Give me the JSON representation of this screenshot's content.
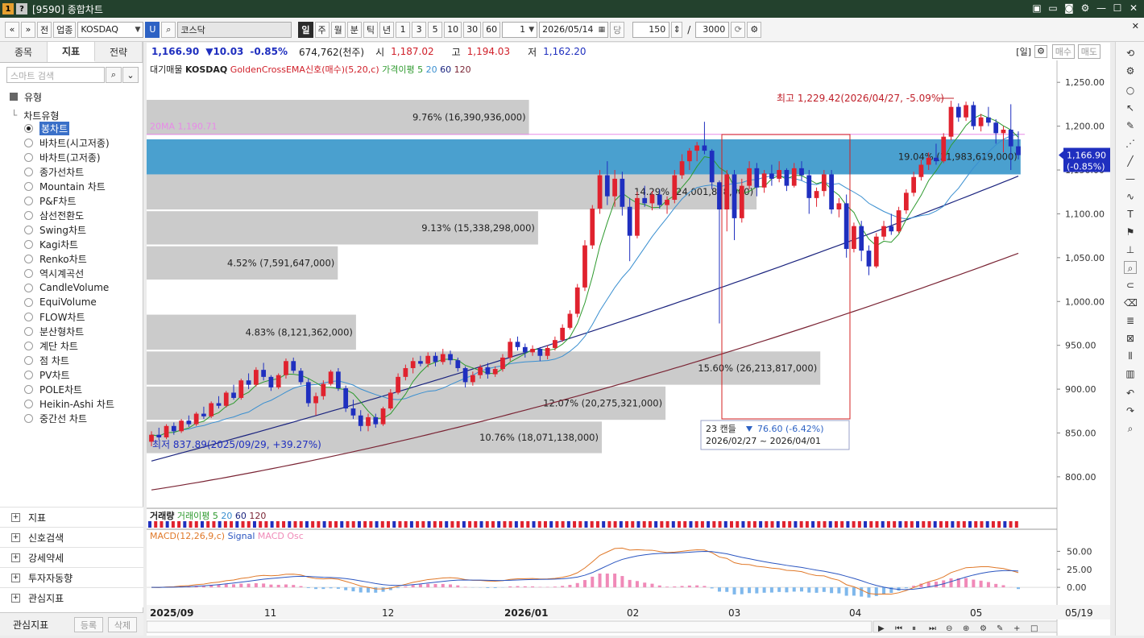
{
  "window": {
    "badge1": "1",
    "badge2": "?",
    "title": "[9590] 종합차트",
    "controls": [
      "▣",
      "▭",
      "◙",
      "⚙",
      "—",
      "☐",
      "✕"
    ]
  },
  "toolbar": {
    "nav_prev": "«",
    "nav_down": "»",
    "btn_prev": "전",
    "btn_sector": "업종",
    "symbol": "KOSDAQ",
    "symbol_code_badge": "U",
    "market": "코스닥",
    "periods": [
      "일",
      "주",
      "월",
      "분",
      "틱",
      "년"
    ],
    "active_period": "일",
    "intervals": [
      "1",
      "3",
      "5",
      "10",
      "30",
      "60"
    ],
    "count_select": "1",
    "date": "2026/05/14",
    "date_unit_btn": "당",
    "bars": "150",
    "slash": "/",
    "max_bars": "3000"
  },
  "left": {
    "tabs": [
      "종목",
      "지표",
      "전략"
    ],
    "active_tab": "지표",
    "search_placeholder": "스마트 검색",
    "section": "유형",
    "tree_group": "차트유형",
    "chart_types": [
      "봉차트",
      "바차트(시고저종)",
      "바차트(고저종)",
      "종가선차트",
      "Mountain 차트",
      "P&F차트",
      "삼선전환도",
      "Swing차트",
      "Kagi차트",
      "Renko차트",
      "역시계곡선",
      "CandleVolume",
      "EquiVolume",
      "FLOW차트",
      "분산형차트",
      "계단 차트",
      "점 차트",
      "PV차트",
      "POLE차트",
      "Heikin-Ashi 차트",
      "중간선 차트"
    ],
    "selected_type": "봉차트",
    "accordions": [
      "지표",
      "신호검색",
      "강세약세",
      "투자자동향",
      "관심지표"
    ],
    "footer": {
      "label": "관심지표",
      "register": "등록",
      "delete": "삭제"
    }
  },
  "pricebar": {
    "price": "1,166.90",
    "change": "▼10.03",
    "pct": "-0.85%",
    "volume": "674,762(천주)",
    "open_label": "시",
    "open": "1,187.02",
    "high_label": "고",
    "high": "1,194.03",
    "low_label": "저",
    "low": "1,162.20",
    "period_badge": "[일]",
    "buy": "매수",
    "sell": "매도"
  },
  "main_legend": {
    "items": [
      "대기매물",
      "KOSDAQ",
      "GoldenCrossEMA신호(매수)(5,20,c)",
      "가격이평 5",
      "20",
      "60",
      "120"
    ]
  },
  "annotations": {
    "high": "최고 1,229.42(2026/04/27, -5.09%)",
    "low": "최저 837.89(2025/09/29, +39.27%)",
    "ma20": "20MA 1,190.71",
    "price_tag": "1,166.90",
    "pct_tag": "(-0.85%)",
    "box_line1": "23 캔들",
    "box_value": "76.60 (-6.42%)",
    "box_line2": "2026/02/27 ~ 2026/04/01"
  },
  "volume_profile": [
    {
      "low": 1190,
      "high": 1230,
      "width": 0.42,
      "label": "9.76% (16,390,936,000)",
      "hl": false
    },
    {
      "low": 1145,
      "high": 1185,
      "width": 0.96,
      "label": "19.04% (31,983,619,000)",
      "hl": true
    },
    {
      "low": 1105,
      "high": 1145,
      "width": 0.67,
      "label": "14.29% (24,001,828,000)",
      "hl": false
    },
    {
      "low": 1065,
      "high": 1103,
      "width": 0.43,
      "label": "9.13% (15,338,298,000)",
      "hl": false
    },
    {
      "low": 1025,
      "high": 1063,
      "width": 0.21,
      "label": "4.52% (7,591,647,000)",
      "hl": false
    },
    {
      "low": 945,
      "high": 985,
      "width": 0.23,
      "label": "4.83% (8,121,362,000)",
      "hl": false
    },
    {
      "low": 905,
      "high": 943,
      "width": 0.74,
      "label": "15.60% (26,213,817,000)",
      "hl": false
    },
    {
      "low": 865,
      "high": 903,
      "width": 0.57,
      "label": "12.07% (20,275,321,000)",
      "hl": false
    },
    {
      "low": 827,
      "high": 863,
      "width": 0.5,
      "label": "10.76% (18,071,138,000)",
      "hl": false
    }
  ],
  "volume_legend": {
    "items": [
      "거래량",
      "거래이평 5",
      "20",
      "60",
      "120"
    ]
  },
  "macd_legend": {
    "items": [
      "MACD(12,26,9,c)",
      "Signal",
      "MACD Osc"
    ]
  },
  "chart_data": {
    "type": "candlestick",
    "y_axis_ticks": [
      "1,250.00",
      "1,200.00",
      "1,150.00",
      "1,100.00",
      "1,050.00",
      "1,000.00",
      "950.00",
      "900.00",
      "850.00",
      "800.00"
    ],
    "ylim": [
      765,
      1275
    ],
    "macd_ticks": [
      "50.00",
      "25.00",
      "0.00"
    ],
    "macd_ylim": [
      -20,
      65
    ],
    "x_labels": [
      "2025/09",
      "11",
      "12",
      "2026/01",
      "02",
      "03",
      "04",
      "05"
    ],
    "last_date": "05/19",
    "candles": [
      [
        840,
        852,
        835,
        848
      ],
      [
        848,
        856,
        842,
        845
      ],
      [
        845,
        860,
        843,
        858
      ],
      [
        858,
        862,
        848,
        852
      ],
      [
        852,
        866,
        850,
        864
      ],
      [
        864,
        870,
        857,
        860
      ],
      [
        860,
        874,
        858,
        872
      ],
      [
        872,
        880,
        866,
        869
      ],
      [
        869,
        886,
        867,
        884
      ],
      [
        884,
        892,
        878,
        881
      ],
      [
        881,
        898,
        879,
        896
      ],
      [
        896,
        905,
        888,
        890
      ],
      [
        890,
        912,
        888,
        910
      ],
      [
        910,
        918,
        900,
        905
      ],
      [
        905,
        925,
        903,
        922
      ],
      [
        922,
        930,
        910,
        914
      ],
      [
        914,
        916,
        898,
        902
      ],
      [
        902,
        918,
        900,
        916
      ],
      [
        916,
        935,
        912,
        932
      ],
      [
        932,
        936,
        918,
        921
      ],
      [
        921,
        924,
        905,
        908
      ],
      [
        908,
        912,
        880,
        884
      ],
      [
        884,
        896,
        870,
        892
      ],
      [
        892,
        910,
        888,
        906
      ],
      [
        906,
        922,
        904,
        920
      ],
      [
        920,
        924,
        898,
        901
      ],
      [
        901,
        904,
        874,
        878
      ],
      [
        878,
        888,
        866,
        870
      ],
      [
        870,
        876,
        852,
        858
      ],
      [
        858,
        872,
        852,
        868
      ],
      [
        868,
        872,
        856,
        860
      ],
      [
        860,
        880,
        858,
        878
      ],
      [
        878,
        900,
        876,
        896
      ],
      [
        896,
        918,
        894,
        914
      ],
      [
        914,
        928,
        910,
        924
      ],
      [
        924,
        936,
        918,
        932
      ],
      [
        932,
        938,
        926,
        929
      ],
      [
        929,
        942,
        925,
        938
      ],
      [
        938,
        942,
        926,
        931
      ],
      [
        931,
        946,
        928,
        940
      ],
      [
        940,
        944,
        928,
        933
      ],
      [
        933,
        936,
        920,
        924
      ],
      [
        924,
        926,
        902,
        908
      ],
      [
        908,
        920,
        904,
        916
      ],
      [
        916,
        928,
        912,
        925
      ],
      [
        925,
        930,
        912,
        917
      ],
      [
        917,
        926,
        914,
        923
      ],
      [
        923,
        940,
        920,
        936
      ],
      [
        936,
        958,
        932,
        954
      ],
      [
        954,
        960,
        944,
        948
      ],
      [
        948,
        952,
        936,
        942
      ],
      [
        942,
        950,
        938,
        946
      ],
      [
        946,
        948,
        932,
        938
      ],
      [
        938,
        950,
        934,
        947
      ],
      [
        947,
        960,
        944,
        956
      ],
      [
        956,
        974,
        954,
        970
      ],
      [
        970,
        990,
        968,
        986
      ],
      [
        986,
        1020,
        982,
        1016
      ],
      [
        1016,
        1070,
        1012,
        1064
      ],
      [
        1064,
        1110,
        1060,
        1106
      ],
      [
        1106,
        1150,
        1100,
        1144
      ],
      [
        1144,
        1160,
        1110,
        1120
      ],
      [
        1120,
        1150,
        1108,
        1140
      ],
      [
        1140,
        1148,
        1098,
        1108
      ],
      [
        1108,
        1118,
        1046,
        1075
      ],
      [
        1075,
        1125,
        1072,
        1118
      ],
      [
        1118,
        1132,
        1108,
        1112
      ],
      [
        1112,
        1126,
        1104,
        1122
      ],
      [
        1122,
        1128,
        1106,
        1110
      ],
      [
        1110,
        1120,
        1100,
        1116
      ],
      [
        1116,
        1150,
        1112,
        1144
      ],
      [
        1144,
        1168,
        1140,
        1160
      ],
      [
        1160,
        1175,
        1150,
        1172
      ],
      [
        1172,
        1182,
        1160,
        1178
      ],
      [
        1178,
        1205,
        1168,
        1172
      ],
      [
        1172,
        1174,
        1128,
        1136
      ],
      [
        1136,
        1138,
        975,
        1105
      ],
      [
        1105,
        1150,
        1080,
        1145
      ],
      [
        1145,
        1150,
        1070,
        1095
      ],
      [
        1095,
        1140,
        1090,
        1132
      ],
      [
        1132,
        1160,
        1128,
        1152
      ],
      [
        1152,
        1158,
        1120,
        1130
      ],
      [
        1130,
        1150,
        1124,
        1146
      ],
      [
        1146,
        1156,
        1132,
        1140
      ],
      [
        1140,
        1160,
        1136,
        1150
      ],
      [
        1150,
        1152,
        1126,
        1132
      ],
      [
        1132,
        1158,
        1130,
        1152
      ],
      [
        1152,
        1160,
        1138,
        1144
      ],
      [
        1144,
        1150,
        1100,
        1118
      ],
      [
        1118,
        1130,
        1108,
        1126
      ],
      [
        1126,
        1150,
        1120,
        1145
      ],
      [
        1145,
        1150,
        1100,
        1105
      ],
      [
        1105,
        1118,
        1096,
        1112
      ],
      [
        1112,
        1122,
        1050,
        1060
      ],
      [
        1060,
        1090,
        1056,
        1086
      ],
      [
        1086,
        1092,
        1046,
        1058
      ],
      [
        1058,
        1064,
        1030,
        1040
      ],
      [
        1040,
        1078,
        1038,
        1074
      ],
      [
        1074,
        1092,
        1070,
        1086
      ],
      [
        1086,
        1100,
        1076,
        1080
      ],
      [
        1080,
        1108,
        1078,
        1104
      ],
      [
        1104,
        1128,
        1100,
        1124
      ],
      [
        1124,
        1148,
        1120,
        1142
      ],
      [
        1142,
        1162,
        1138,
        1156
      ],
      [
        1156,
        1170,
        1150,
        1164
      ],
      [
        1164,
        1180,
        1156,
        1160
      ],
      [
        1160,
        1192,
        1158,
        1188
      ],
      [
        1188,
        1229,
        1184,
        1222
      ],
      [
        1222,
        1226,
        1205,
        1210
      ],
      [
        1210,
        1228,
        1206,
        1224
      ],
      [
        1224,
        1228,
        1196,
        1200
      ],
      [
        1200,
        1214,
        1194,
        1210
      ],
      [
        1210,
        1222,
        1200,
        1204
      ],
      [
        1204,
        1208,
        1180,
        1192
      ],
      [
        1192,
        1200,
        1170,
        1196
      ],
      [
        1196,
        1225,
        1150,
        1177
      ],
      [
        1177,
        1194,
        1162,
        1167
      ]
    ],
    "price_line": 1190.71,
    "series": [
      {
        "name": "가격이평 5",
        "color": "#2e9a2e"
      },
      {
        "name": "20",
        "color": "#3a8fd0"
      },
      {
        "name": "60",
        "color": "#1a237e"
      },
      {
        "name": "120",
        "color": "#7a2434"
      }
    ],
    "volume_bars": 150,
    "macd_series": [
      {
        "name": "MACD(12,26,9,c)",
        "color": "#e07828"
      },
      {
        "name": "Signal",
        "color": "#2a55c0"
      },
      {
        "name": "MACD Osc",
        "color": "#f08ab8"
      }
    ]
  },
  "colors": {
    "up": "#e0222e",
    "down": "#1f2fbf",
    "highlight": "#4aa0cf",
    "profile": "#c8c8c8",
    "accent": "#3a70c8"
  }
}
